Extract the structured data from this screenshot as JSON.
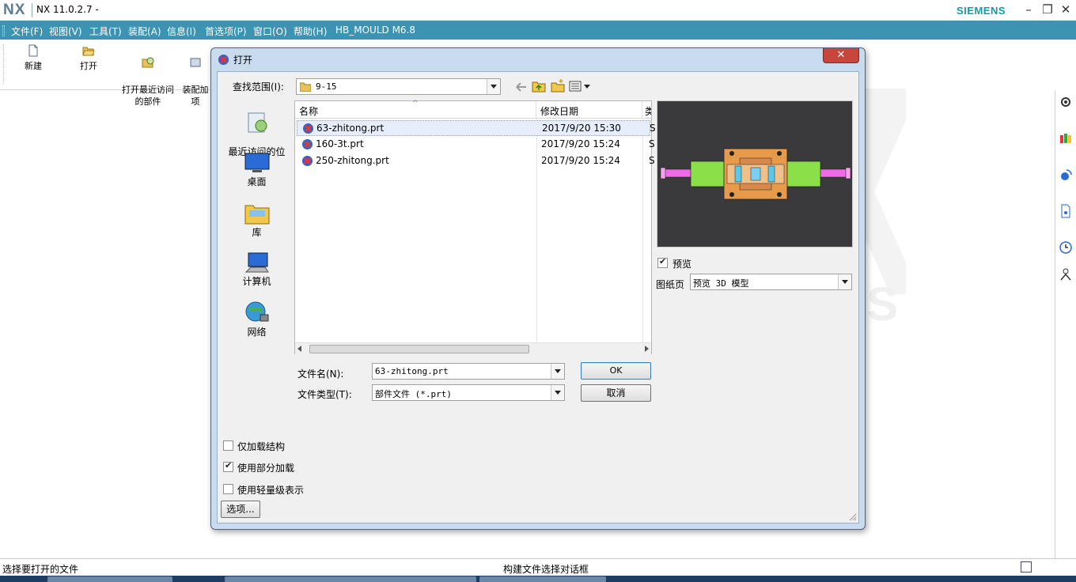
{
  "app": {
    "logo": "NX",
    "title": "NX 11.0.2.7 -",
    "brand": "SIEMENS",
    "brand_color": "#139ba8",
    "menubar_color": "#3c93b2"
  },
  "window_controls": [
    "minimize-icon",
    "restore-icon",
    "close-icon"
  ],
  "menu": [
    {
      "label": "文件(F)"
    },
    {
      "label": "视图(V)"
    },
    {
      "label": "工具(T)"
    },
    {
      "label": "装配(A)"
    },
    {
      "label": "信息(I)"
    },
    {
      "label": "首选项(P)"
    },
    {
      "label": "窗口(O)"
    },
    {
      "label": "帮助(H)"
    },
    {
      "label": "HB_MOULD M6.8"
    }
  ],
  "ribbon": [
    {
      "label": "新建",
      "icon": "new-file-icon"
    },
    {
      "label": "打开",
      "icon": "open-folder-icon"
    },
    {
      "label": "打开最近访问\n的部件",
      "icon": "recent-parts-icon"
    },
    {
      "label": "装配加\n项",
      "icon": "assembly-icon"
    }
  ],
  "dialog": {
    "title": "打开",
    "look_in_label": "查找范围(I):",
    "look_in_value": "9-15",
    "places": [
      {
        "label": "最近访问的位\n置",
        "icon": "recent-places-icon"
      },
      {
        "label": "桌面",
        "icon": "desktop-icon"
      },
      {
        "label": "库",
        "icon": "libraries-icon"
      },
      {
        "label": "计算机",
        "icon": "computer-icon"
      },
      {
        "label": "网络",
        "icon": "network-icon"
      }
    ],
    "columns": {
      "name": "名称",
      "modified": "修改日期",
      "cut": "类"
    },
    "files": [
      {
        "name": "63-zhitong.prt",
        "modified": "2017/9/20 15:30",
        "cut": "S",
        "selected": true
      },
      {
        "name": "160-3t.prt",
        "modified": "2017/9/20 15:24",
        "cut": "S",
        "selected": false
      },
      {
        "name": "250-zhitong.prt",
        "modified": "2017/9/20 15:24",
        "cut": "S",
        "selected": false
      }
    ],
    "filename_label": "文件名(N):",
    "filename_value": "63-zhitong.prt",
    "filetype_label": "文件类型(T):",
    "filetype_value": "部件文件 (*.prt)",
    "ok_label": "OK",
    "cancel_label": "取消",
    "preview_checkbox": {
      "label": "预览",
      "checked": true
    },
    "sheet_label": "图纸页",
    "sheet_value": "预览 3D 模型",
    "options": [
      {
        "label": "仅加载结构",
        "checked": false
      },
      {
        "label": "使用部分加载",
        "checked": true
      },
      {
        "label": "使用轻量级表示",
        "checked": false
      }
    ],
    "options_button": "选项..."
  },
  "status": {
    "left": "选择要打开的文件",
    "middle": "构建文件选择对话框"
  }
}
